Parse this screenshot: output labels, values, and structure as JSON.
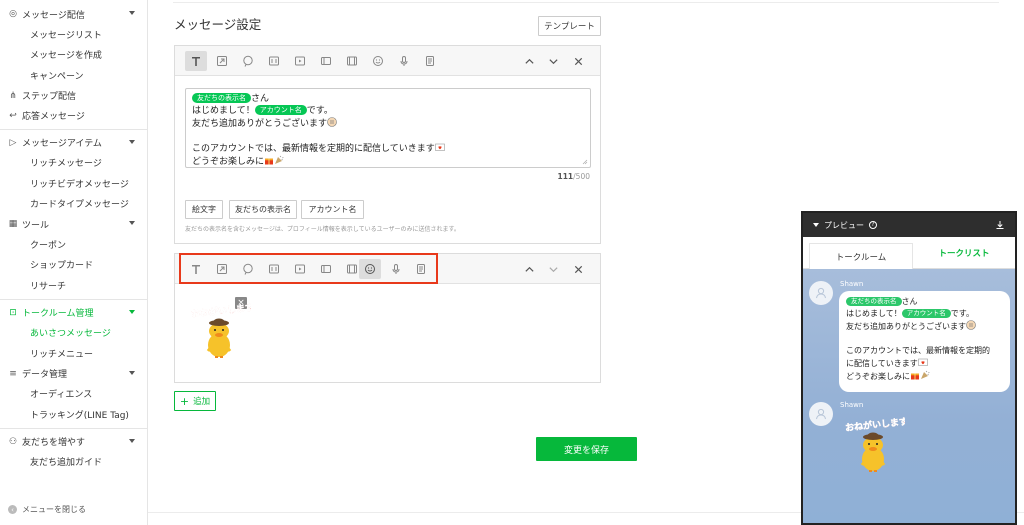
{
  "sidebar": {
    "sections": [
      {
        "label": "メッセージ配信",
        "icon": "broadcast-icon",
        "items": [
          "メッセージリスト",
          "メッセージを作成",
          "キャンペーン"
        ]
      },
      {
        "label": "ステップ配信",
        "icon": "step-icon",
        "items": []
      },
      {
        "label": "応答メッセージ",
        "icon": "reply-icon",
        "items": []
      },
      {
        "label": "メッセージアイテム",
        "icon": "message-item-icon",
        "items": [
          "リッチメッセージ",
          "リッチビデオメッセージ",
          "カードタイプメッセージ"
        ]
      },
      {
        "label": "ツール",
        "icon": "tools-icon",
        "items": [
          "クーポン",
          "ショップカード",
          "リサーチ"
        ]
      },
      {
        "label": "トークルーム管理",
        "icon": "talkroom-icon",
        "items": [
          "あいさつメッセージ",
          "リッチメニュー"
        ]
      },
      {
        "label": "データ管理",
        "icon": "data-icon",
        "items": [
          "オーディエンス",
          "トラッキング(LINE Tag)"
        ]
      },
      {
        "label": "友だちを増やす",
        "icon": "add-friend-icon",
        "items": [
          "友だち追加ガイド"
        ]
      }
    ],
    "collapse_label": "メニューを閉じる"
  },
  "main": {
    "title": "メッセージ設定",
    "template_label": "テンプレート",
    "editor": {
      "tag_display_name": "友だちの表示名",
      "text_san": "さん",
      "text_hello": "はじめまして！",
      "tag_account_name": "アカウント名",
      "text_desu": "です。",
      "text_thanks": "友だち追加ありがとうございます",
      "text_info": "このアカウントでは、最新情報を定期的に配信していきます",
      "text_enjoy": "どうぞお楽しみに",
      "char_count": "111",
      "char_max": "/500"
    },
    "insert_buttons": [
      "絵文字",
      "友だちの表示名",
      "アカウント名"
    ],
    "note": "友だちの表示名を含むメッセージは、プロフィール情報を表示しているユーザーのみに送信されます。",
    "sticker_text": "おねがいします",
    "add_label": "追加",
    "save_label": "変更を保存"
  },
  "preview": {
    "title": "プレビュー",
    "tabs": [
      "トークルーム",
      "トークリスト"
    ],
    "sender": "Shawn",
    "bubble": {
      "line1_tag": "友だちの表示名",
      "line1_text": "さん",
      "line2_text": "はじめまして！",
      "line2_tag": "アカウント名",
      "line2_end": "です。",
      "line3": "友だち追加ありがとうございます",
      "line4": "このアカウントでは、最新情報を定期的",
      "line5": "に配信していきます",
      "line6": "どうぞお楽しみに"
    }
  },
  "colors": {
    "accent": "#06b83b",
    "highlight": "#e8391b",
    "chat_bg": "#9db6d8"
  }
}
